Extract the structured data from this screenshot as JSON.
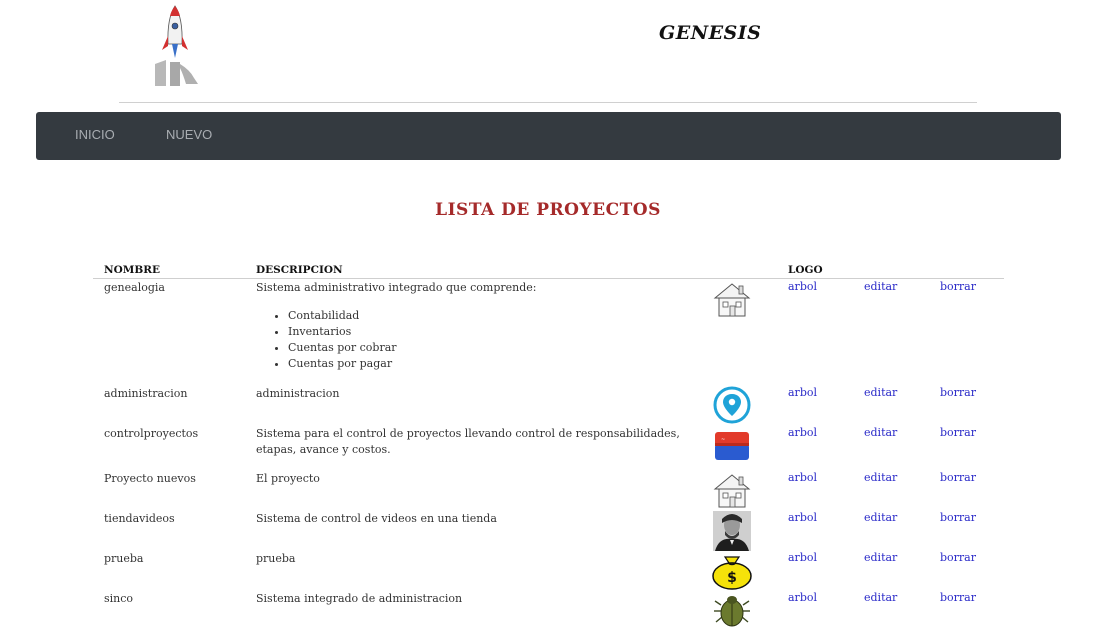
{
  "header": {
    "brand": "GENESIS"
  },
  "nav": {
    "items": [
      "INICIO",
      "NUEVO"
    ]
  },
  "page": {
    "title": "LISTA DE PROYECTOS"
  },
  "table": {
    "columns": {
      "nombre": "NOMBRE",
      "descripcion": "DESCRIPCION",
      "logo": "LOGO"
    },
    "actions": {
      "arbol": "arbol",
      "editar": "editar",
      "borrar": "borrar"
    },
    "rows": [
      {
        "nombre": "genealogia",
        "descripcion": "Sistema administrativo integrado que comprende:",
        "bullets": [
          "Contabilidad",
          "Inventarios",
          "Cuentas por cobrar",
          "Cuentas por pagar"
        ],
        "logo_icon": "house-icon"
      },
      {
        "nombre": "administracion",
        "descripcion": "administracion",
        "logo_icon": "map-pin-icon"
      },
      {
        "nombre": "controlproyectos",
        "descripcion": "Sistema para el control de proyectos llevando control de responsabilidades, etapas, avance y costos.",
        "logo_icon": "eraser-icon"
      },
      {
        "nombre": "Proyecto nuevos",
        "descripcion": "El proyecto",
        "logo_icon": "house-icon"
      },
      {
        "nombre": "tiendavideos",
        "descripcion": "Sistema de control de videos en una tienda",
        "logo_icon": "portrait-icon"
      },
      {
        "nombre": "prueba",
        "descripcion": "prueba",
        "logo_icon": "money-bag-icon"
      },
      {
        "nombre": "sinco",
        "descripcion": "Sistema integrado de administracion",
        "logo_icon": "beetle-icon"
      }
    ]
  }
}
